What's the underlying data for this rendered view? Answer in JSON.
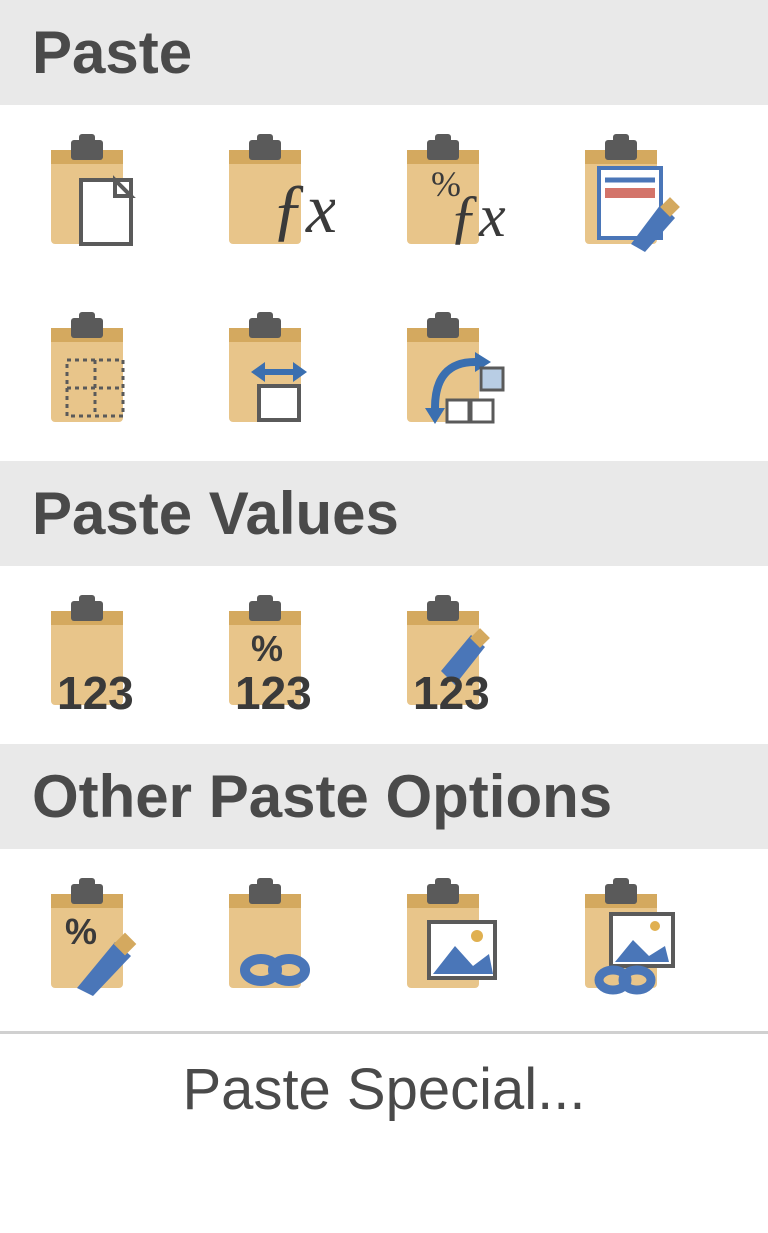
{
  "sections": {
    "paste": {
      "title": "Paste"
    },
    "pasteValues": {
      "title": "Paste Values"
    },
    "otherPaste": {
      "title": "Other Paste Options"
    }
  },
  "pasteSpecial": {
    "label": "Paste Special..."
  },
  "icons": {
    "paste_all": "paste-all-icon",
    "paste_formulas": "paste-formulas-icon",
    "paste_formulas_number": "paste-formulas-number-formatting-icon",
    "paste_keep_source": "paste-keep-source-formatting-icon",
    "paste_no_borders": "paste-no-borders-icon",
    "paste_column_widths": "paste-keep-column-widths-icon",
    "paste_transpose": "paste-transpose-icon",
    "paste_values": "paste-values-icon",
    "paste_values_number": "paste-values-number-formatting-icon",
    "paste_values_source": "paste-values-source-formatting-icon",
    "paste_formatting": "paste-formatting-icon",
    "paste_link": "paste-link-icon",
    "paste_picture": "paste-picture-icon",
    "paste_linked_picture": "paste-linked-picture-icon"
  }
}
